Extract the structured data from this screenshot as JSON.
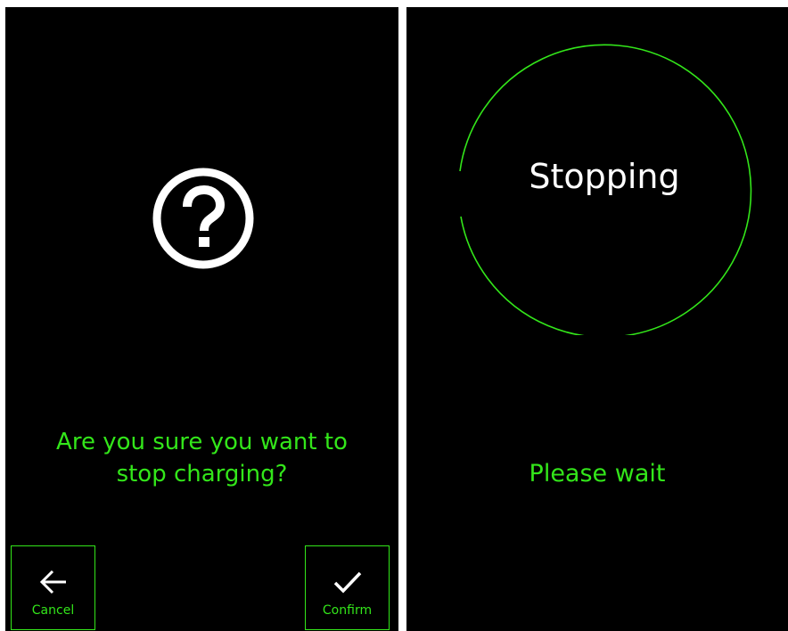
{
  "confirm_screen": {
    "icon": "question-circle-icon",
    "prompt_line1": "Are you sure you want to",
    "prompt_line2": "stop charging?",
    "cancel_button": {
      "label": "Cancel",
      "icon": "arrow-left-icon"
    },
    "confirm_button": {
      "label": "Confirm",
      "icon": "checkmark-icon"
    }
  },
  "stopping_screen": {
    "status_text": "Stopping",
    "wait_text": "Please wait"
  },
  "colors": {
    "background": "#000000",
    "accent": "#33e61a",
    "icon": "#ffffff",
    "status_text": "#ffffff"
  }
}
